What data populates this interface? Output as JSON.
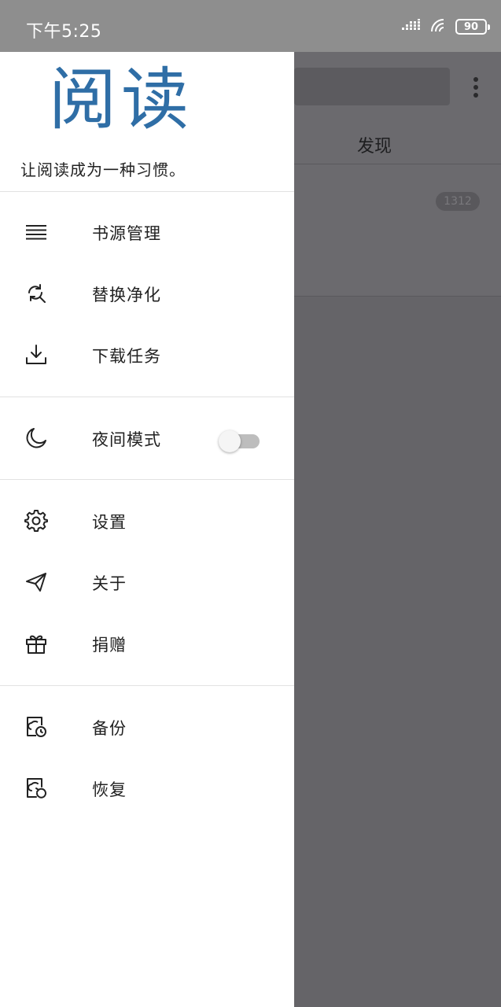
{
  "status_bar": {
    "time": "下午5:25",
    "battery": "90",
    "icons": [
      "signal-icon",
      "wifi-icon",
      "battery-icon"
    ]
  },
  "main": {
    "tab_discover": "发现",
    "count_badge": "1312"
  },
  "drawer": {
    "logo": "阅读",
    "slogan": "让阅读成为一种习惯。",
    "groups": [
      [
        {
          "label": "书源管理",
          "icon": "list-icon"
        },
        {
          "label": "替换净化",
          "icon": "replace-search-icon"
        },
        {
          "label": "下载任务",
          "icon": "download-icon"
        }
      ],
      [
        {
          "label": "夜间模式",
          "icon": "moon-icon",
          "toggle": false
        }
      ],
      [
        {
          "label": "设置",
          "icon": "gear-icon"
        },
        {
          "label": "关于",
          "icon": "send-icon"
        },
        {
          "label": "捐赠",
          "icon": "gift-icon"
        }
      ],
      [
        {
          "label": "备份",
          "icon": "backup-icon"
        },
        {
          "label": "恢复",
          "icon": "restore-icon"
        }
      ]
    ]
  },
  "colors": {
    "logo": "#2f6ea6",
    "scrim": "#656468",
    "status_bar": "#8e8e8e"
  }
}
